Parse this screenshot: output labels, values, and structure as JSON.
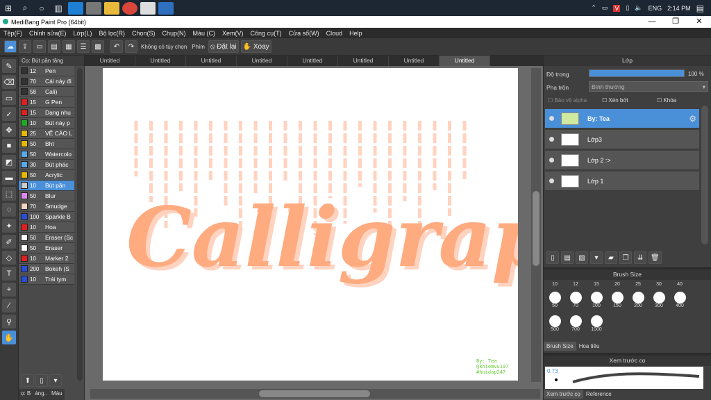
{
  "taskbar": {
    "lang": "ENG",
    "time": "2:14 PM"
  },
  "window": {
    "title": "MediBang Paint Pro (64bit)"
  },
  "menu": [
    "Tệp(F)",
    "Chỉnh sửa(E)",
    "Lớp(L)",
    "Bộ lọc(R)",
    "Chọn(S)",
    "Chụp(N)",
    "Màu (C)",
    "Xem(V)",
    "Công cụ(T)",
    "Cửa sổ(W)",
    "Cloud",
    "Help"
  ],
  "toolbar": {
    "mode_label": "Không có tùy chọn",
    "phim_label": "Phím",
    "reset_label": "Đặt lại",
    "rotate_label": "Xoay"
  },
  "brush_panel": {
    "header": "Cọ: Bút pần tăng",
    "brushes": [
      {
        "size": "12",
        "name": "Pen",
        "color": "#333333"
      },
      {
        "size": "70",
        "name": "Cái này đi",
        "color": "#333333"
      },
      {
        "size": "58",
        "name": "Cali)",
        "color": "#333333"
      },
      {
        "size": "15",
        "name": "G Pen",
        "color": "#e02020"
      },
      {
        "size": "15",
        "name": "Dạng nhu",
        "color": "#e02020"
      },
      {
        "size": "10",
        "name": "Bút này p",
        "color": "#22aa22"
      },
      {
        "size": "25",
        "name": "VẼ CÁO L",
        "color": "#e6b800"
      },
      {
        "size": "50",
        "name": "Bht",
        "color": "#e6b800"
      },
      {
        "size": "50",
        "name": "Watercolo",
        "color": "#55aaee"
      },
      {
        "size": "30",
        "name": "Bút phác",
        "color": "#55aaee"
      },
      {
        "size": "50",
        "name": "Acrylic",
        "color": "#e6b800"
      },
      {
        "size": "10",
        "name": "Bút pần",
        "color": "#cccccc"
      },
      {
        "size": "50",
        "name": "Blur",
        "color": "#dd88ee"
      },
      {
        "size": "70",
        "name": "Smudge",
        "color": "#f5d5c0"
      },
      {
        "size": "100",
        "name": "Sparkle B",
        "color": "#2a4ed8"
      },
      {
        "size": "10",
        "name": "Hoa",
        "color": "#e02020"
      },
      {
        "size": "50",
        "name": "Eraser (Sc",
        "color": "#ffffff"
      },
      {
        "size": "50",
        "name": "Eraser",
        "color": "#ffffff"
      },
      {
        "size": "10",
        "name": "Marker 2",
        "color": "#e02020"
      },
      {
        "size": "200",
        "name": "Bokeh (S",
        "color": "#2a4ed8"
      },
      {
        "size": "10",
        "name": "Trái tym",
        "color": "#2a4ed8"
      }
    ],
    "tabs": [
      "ọ: B",
      "áng..",
      "Màu"
    ]
  },
  "canvas": {
    "tabs": [
      "Untitled",
      "Untitled",
      "Untitled",
      "Untitled",
      "Untitled",
      "Untitled",
      "Untitled",
      "Untitled"
    ],
    "art_text": "Calligraphy",
    "signature": [
      "By: Tea",
      "@khiemvu197",
      "#hoidap247"
    ]
  },
  "layers": {
    "title": "Lớp",
    "opacity_label": "Độ trong",
    "opacity_value": "100 %",
    "blend_label": "Pha trộn",
    "blend_value": "Bình thường",
    "protect_alpha": "Bảo vệ alpha",
    "clip": "Xén bớt",
    "lock": "Khóa",
    "items": [
      "By: Tea",
      "Lớp3",
      "Lớp 2 :>",
      "Lớp 1"
    ]
  },
  "brush_size": {
    "title": "Brush Size",
    "top_sizes": [
      "10",
      "12",
      "15",
      "20",
      "25",
      "30",
      "40"
    ],
    "sizes": [
      "50",
      "70",
      "100",
      "150",
      "200",
      "300",
      "400",
      "500",
      "700",
      "1000"
    ],
    "tabs": [
      "Brush Size",
      "Hoa tiêu"
    ]
  },
  "preview": {
    "title": "Xem trước cọ",
    "value": "0.73",
    "tabs": [
      "Xem trước cọ",
      "Reference"
    ]
  },
  "colors": {
    "accent": "#4a90d9",
    "art": "#ffab80",
    "signature": "#66cc33"
  }
}
